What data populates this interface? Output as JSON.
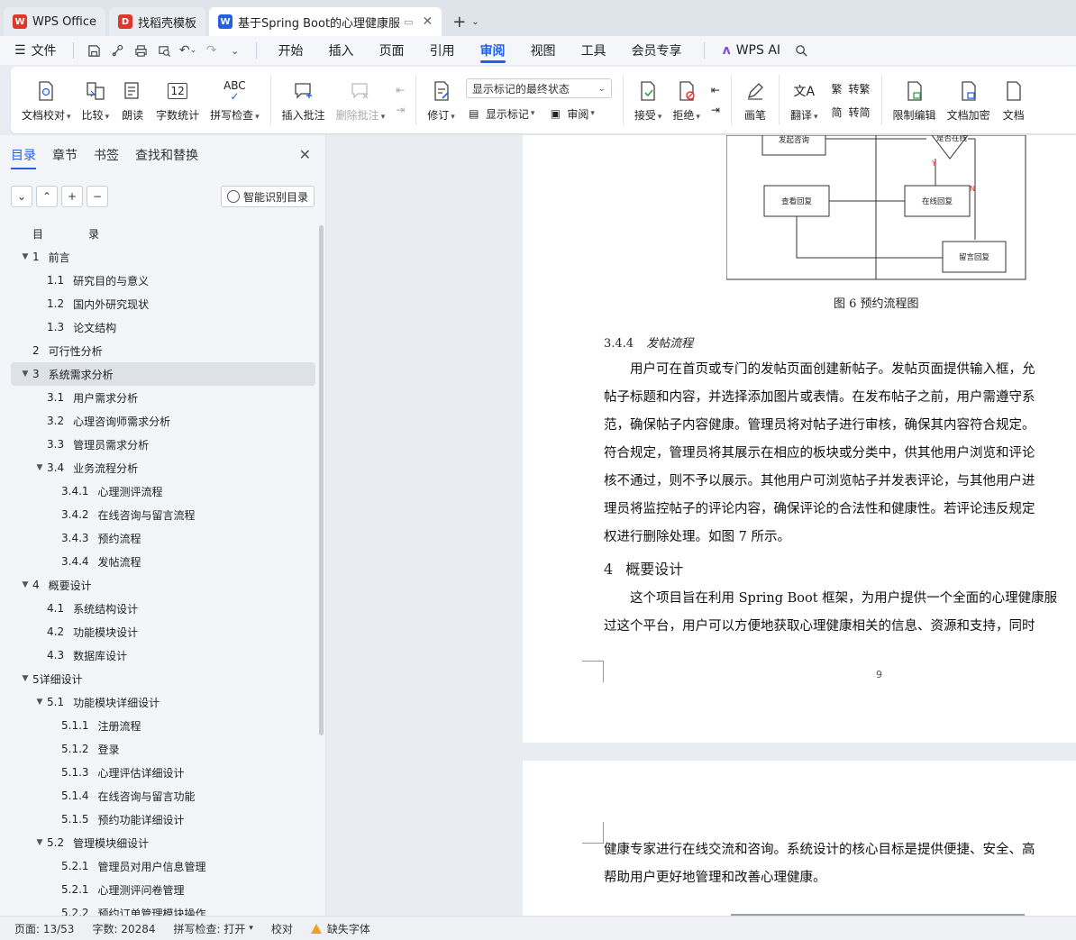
{
  "tabs": [
    {
      "label": "WPS Office",
      "logo": "W",
      "color": "#e0362c"
    },
    {
      "label": "找稻壳模板",
      "logo": "D",
      "color": "#e0362c"
    },
    {
      "label": "基于Spring Boot的心理健康服",
      "logo": "W",
      "color": "#2560e0"
    }
  ],
  "menubar": {
    "file": "文件",
    "items": [
      "开始",
      "插入",
      "页面",
      "引用",
      "审阅",
      "视图",
      "工具",
      "会员专享"
    ],
    "active": "审阅",
    "ai": "WPS AI"
  },
  "ribbon": {
    "proofread": "文档校对",
    "compare": "比较",
    "read_aloud": "朗读",
    "word_count": "字数统计",
    "spell_check": "拼写检查",
    "spell_icon_text": "ABC",
    "count_icon_text": "12",
    "insert_comment": "插入批注",
    "delete_comment": "删除批注",
    "track": "修订",
    "markup_select": "显示标记的最终状态",
    "show_markup": "显示标记",
    "review": "审阅",
    "accept": "接受",
    "reject": "拒绝",
    "draw": "画笔",
    "translate": "翻译",
    "to_traditional": "转繁",
    "to_simplified": "转简",
    "restrict_edit": "限制编辑",
    "encrypt": "文档加密",
    "doc_more": "文档"
  },
  "panel": {
    "tabs": [
      "目录",
      "章节",
      "书签",
      "查找和替换"
    ],
    "smart_toc": "智能识别目录",
    "toc": [
      {
        "num": "目",
        "text": "录",
        "level": 0,
        "arrow": ""
      },
      {
        "num": "1",
        "text": "前言",
        "level": 0,
        "arrow": "▼"
      },
      {
        "num": "1.1",
        "text": "研究目的与意义",
        "level": 1,
        "arrow": ""
      },
      {
        "num": "1.2",
        "text": "国内外研究现状",
        "level": 1,
        "arrow": ""
      },
      {
        "num": "1.3",
        "text": "论文结构",
        "level": 1,
        "arrow": ""
      },
      {
        "num": "2",
        "text": "可行性分析",
        "level": 0,
        "arrow": ""
      },
      {
        "num": "3",
        "text": "系统需求分析",
        "level": 0,
        "arrow": "▼",
        "selected": true
      },
      {
        "num": "3.1",
        "text": "用户需求分析",
        "level": 1,
        "arrow": ""
      },
      {
        "num": "3.2",
        "text": "心理咨询师需求分析",
        "level": 1,
        "arrow": ""
      },
      {
        "num": "3.3",
        "text": "管理员需求分析",
        "level": 1,
        "arrow": ""
      },
      {
        "num": "3.4",
        "text": "业务流程分析",
        "level": 1,
        "arrow": "▼"
      },
      {
        "num": "3.4.1",
        "text": "心理测评流程",
        "level": 2,
        "arrow": ""
      },
      {
        "num": "3.4.2",
        "text": "在线咨询与留言流程",
        "level": 2,
        "arrow": ""
      },
      {
        "num": "3.4.3",
        "text": "预约流程",
        "level": 2,
        "arrow": ""
      },
      {
        "num": "3.4.4",
        "text": "发帖流程",
        "level": 2,
        "arrow": ""
      },
      {
        "num": "4",
        "text": "概要设计",
        "level": 0,
        "arrow": "▼"
      },
      {
        "num": "4.1",
        "text": "系统结构设计",
        "level": 1,
        "arrow": ""
      },
      {
        "num": "4.2",
        "text": "功能模块设计",
        "level": 1,
        "arrow": ""
      },
      {
        "num": "4.3",
        "text": "数据库设计",
        "level": 1,
        "arrow": ""
      },
      {
        "num": "5详细设计",
        "text": "",
        "level": 0,
        "arrow": "▼"
      },
      {
        "num": "5.1",
        "text": "功能模块详细设计",
        "level": 1,
        "arrow": "▼"
      },
      {
        "num": "5.1.1",
        "text": "注册流程",
        "level": 2,
        "arrow": ""
      },
      {
        "num": "5.1.2",
        "text": "登录",
        "level": 2,
        "arrow": ""
      },
      {
        "num": "5.1.3",
        "text": "心理评估详细设计",
        "level": 2,
        "arrow": ""
      },
      {
        "num": "5.1.4",
        "text": "在线咨询与留言功能",
        "level": 2,
        "arrow": ""
      },
      {
        "num": "5.1.5",
        "text": "预约功能详细设计",
        "level": 2,
        "arrow": ""
      },
      {
        "num": "5.2",
        "text": "管理模块细设计",
        "level": 1,
        "arrow": "▼"
      },
      {
        "num": "5.2.1",
        "text": "管理员对用户信息管理",
        "level": 2,
        "arrow": ""
      },
      {
        "num": "5.2.1",
        "text": "心理测评问卷管理",
        "level": 2,
        "arrow": ""
      },
      {
        "num": "5.2.2",
        "text": "预约订单管理模块操作",
        "level": 2,
        "arrow": ""
      }
    ]
  },
  "doc": {
    "flow": {
      "start": "发起咨询",
      "decision": "是否在线",
      "yes": "Y",
      "no": "N",
      "view_reply": "查看回复",
      "online_reply": "在线回复",
      "message_reply": "留言回复"
    },
    "figure_caption": "图 6  预约流程图",
    "sec_344_num": "3.4.4",
    "sec_344_title": "发帖流程",
    "para1": [
      "　　用户可在首页或专门的发帖页面创建新帖子。发帖页面提供输入框，允",
      "帖子标题和内容，并选择添加图片或表情。在发布帖子之前，用户需遵守系",
      "范，确保帖子内容健康。管理员将对帖子进行审核，确保其内容符合规定。",
      "符合规定，管理员将其展示在相应的板块或分类中，供其他用户浏览和评论",
      "核不通过，则不予以展示。其他用户可浏览帖子并发表评论，与其他用户进",
      "理员将监控帖子的评论内容，确保评论的合法性和健康性。若评论违反规定",
      "权进行删除处理。如图 7 所示。"
    ],
    "sec_4_num": "4",
    "sec_4_title": "概要设计",
    "para2": [
      "　　这个项目旨在利用 Spring Boot 框架，为用户提供一个全面的心理健康服",
      "过这个平台，用户可以方便地获取心理健康相关的信息、资源和支持，同时"
    ],
    "page_number": "9",
    "para3": [
      "健康专家进行在线交流和咨询。系统设计的核心目标是提供便捷、安全、高",
      "帮助用户更好地管理和改善心理健康。"
    ]
  },
  "status": {
    "page": "页面: 13/53",
    "words": "字数: 20284",
    "spell": "拼写检查: 打开",
    "proof": "校对",
    "missing_font": "缺失字体"
  }
}
